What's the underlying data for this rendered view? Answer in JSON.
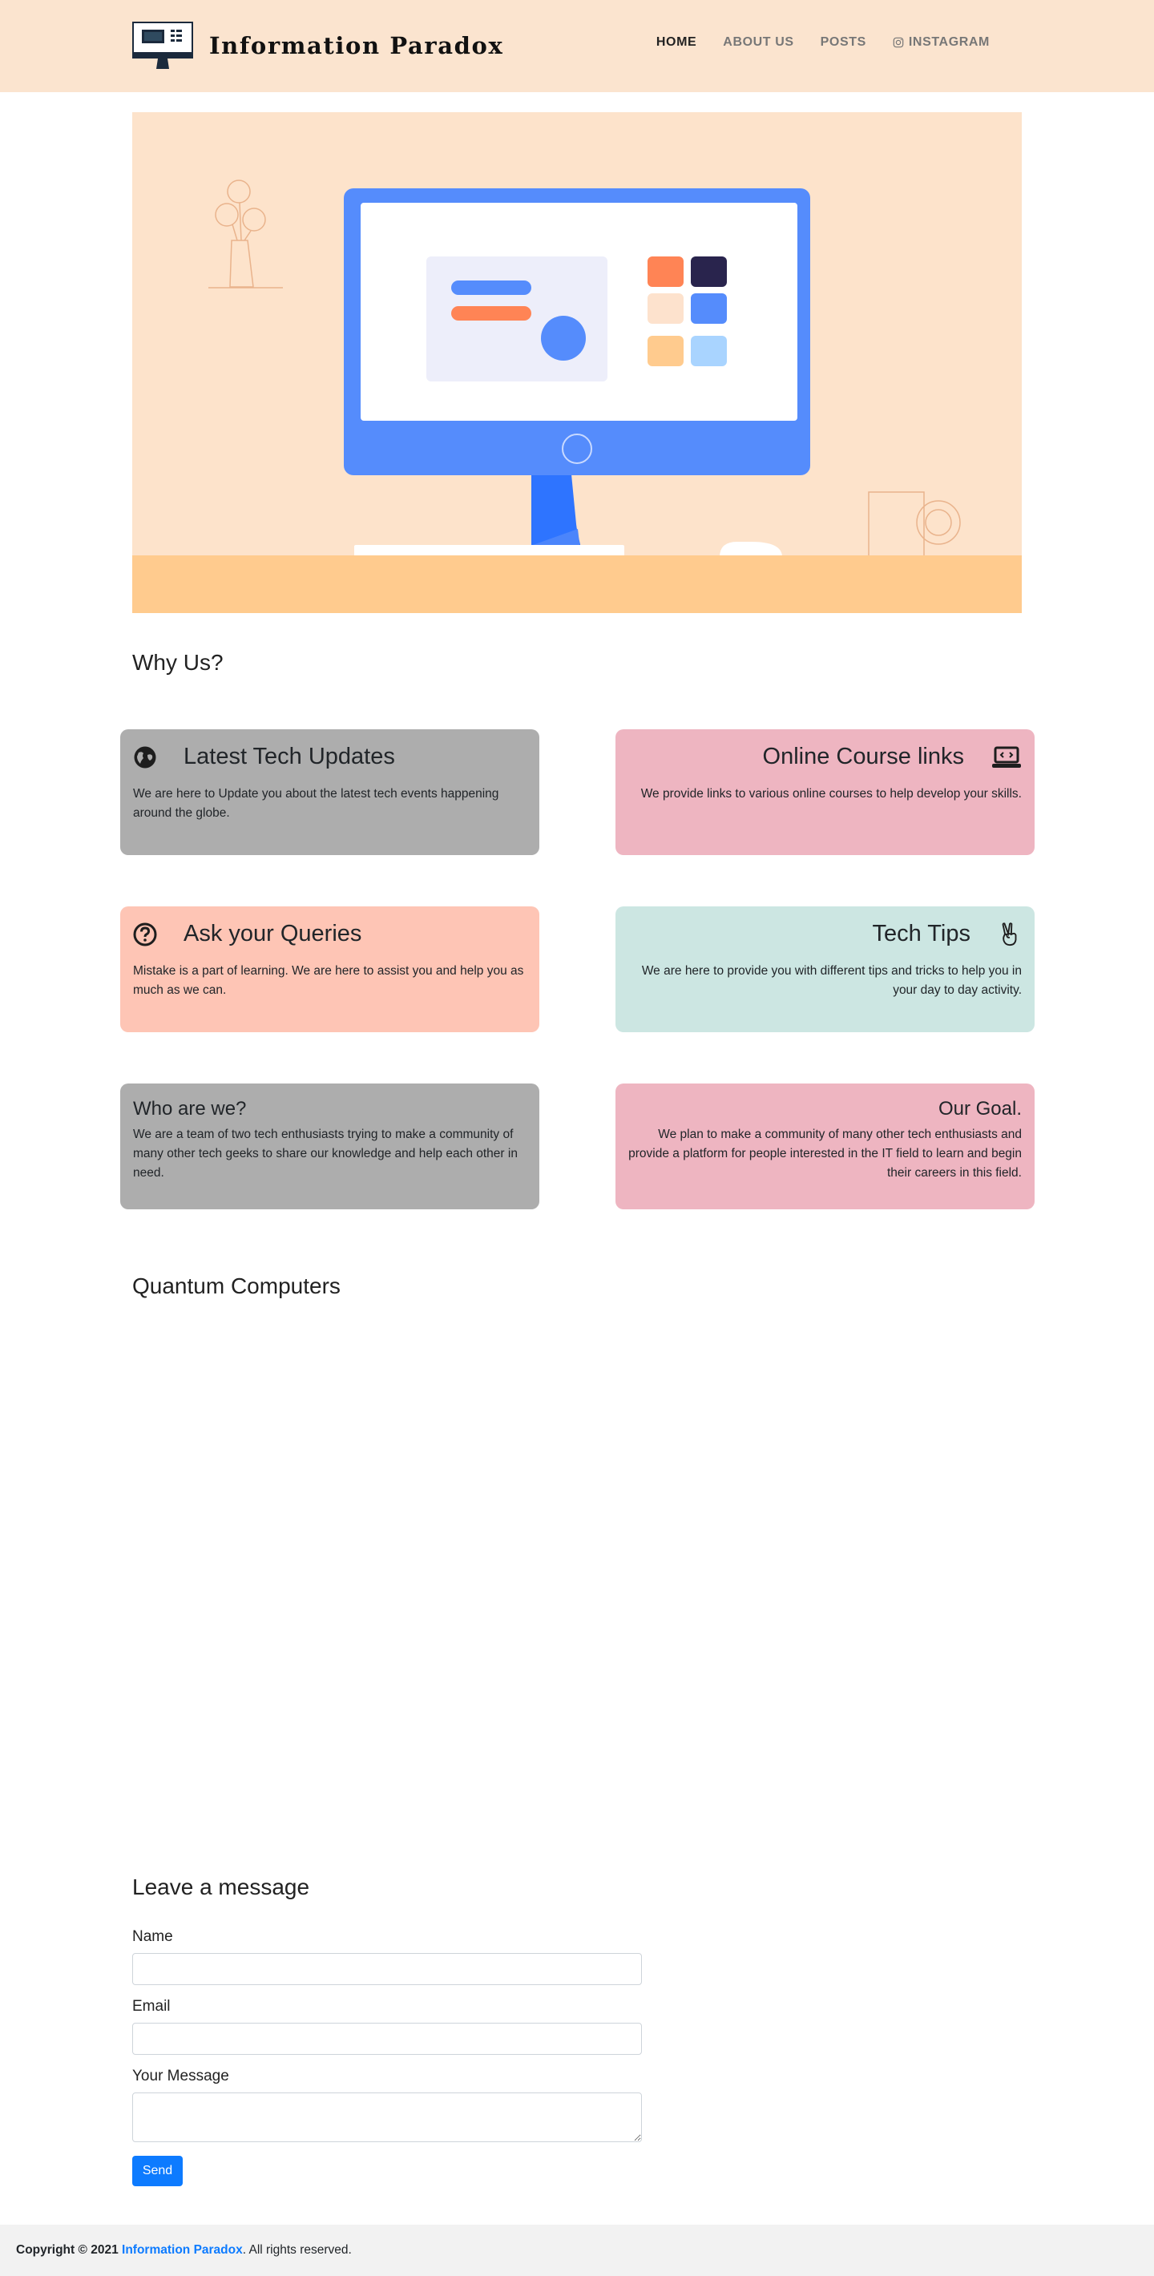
{
  "brand": {
    "title": "Information Paradox"
  },
  "nav": {
    "items": [
      {
        "label": "HOME",
        "active": true
      },
      {
        "label": "ABOUT US",
        "active": false
      },
      {
        "label": "POSTS",
        "active": false
      },
      {
        "label": "INSTAGRAM",
        "active": false,
        "icon": "instagram-icon"
      }
    ]
  },
  "colors": {
    "header_bg": "#fbe4cf",
    "hero_bg": "#fde3cb",
    "hero_desk": "#ffcb8e",
    "monitor_blue": "#558cfc",
    "accent_blue": "#0d7bff",
    "card_gray": "#adadad",
    "card_pink": "#eeb5c1",
    "card_salmon": "#fec5b5",
    "card_mint": "#cce6e2"
  },
  "why_us": {
    "title": "Why Us?",
    "cards": [
      {
        "title": "Latest Tech Updates",
        "text": "We are here to Update you about the latest tech events happening around the globe.",
        "icon": "globe-icon"
      },
      {
        "title": "Online Course links",
        "text": "We provide links to various online courses to help develop your skills.",
        "icon": "laptop-code-icon"
      },
      {
        "title": "Ask your Queries",
        "text": "Mistake is a part of learning. We are here to assist you and help you as much as we can.",
        "icon": "question-circle-icon"
      },
      {
        "title": "Tech Tips",
        "text": "We are here to provide you with different tips and tricks to help you in your day to day activity.",
        "icon": "victory-hand-icon"
      },
      {
        "title": "Who are we?",
        "text": "We are a team of two tech enthusiasts trying to make a community of many other tech geeks to share our knowledge and help each other in need."
      },
      {
        "title": "Our Goal.",
        "text": "We plan to make a community of many other tech enthusiasts and provide a platform for people interested in the IT field to learn and begin their careers in this field."
      }
    ]
  },
  "quantum": {
    "title": "Quantum Computers"
  },
  "contact": {
    "title": "Leave a message",
    "name_label": "Name",
    "name_value": "",
    "email_label": "Email",
    "email_value": "",
    "message_label": "Your Message",
    "message_value": "",
    "send_label": "Send"
  },
  "footer": {
    "copyright": "Copyright © 2021",
    "brand_link": "Information Paradox",
    "rights": ". All rights reserved."
  }
}
